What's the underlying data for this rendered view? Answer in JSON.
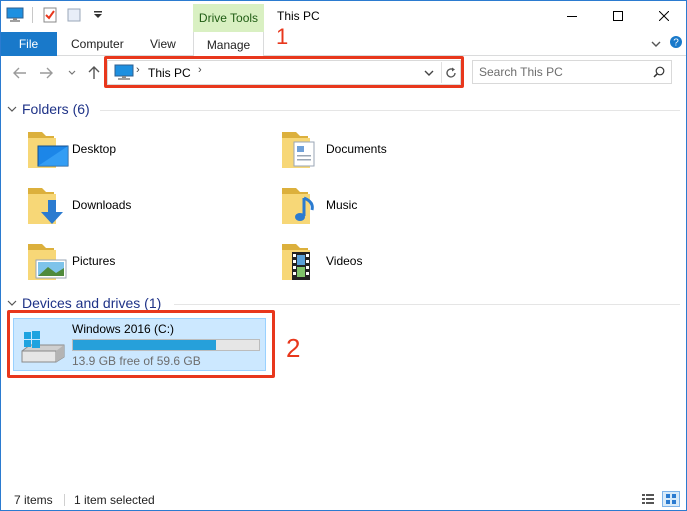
{
  "window": {
    "title": "This PC",
    "contextual_tab": "Drive Tools"
  },
  "ribbon": {
    "tabs": [
      "File",
      "Computer",
      "View",
      "Manage"
    ]
  },
  "annotations": {
    "one": "1",
    "two": "2"
  },
  "address_bar": {
    "location": "This PC"
  },
  "search": {
    "placeholder": "Search This PC"
  },
  "folders": {
    "header": "Folders (6)",
    "items": [
      {
        "label": "Desktop",
        "icon": "desktop-folder-icon"
      },
      {
        "label": "Documents",
        "icon": "documents-folder-icon"
      },
      {
        "label": "Downloads",
        "icon": "downloads-folder-icon"
      },
      {
        "label": "Music",
        "icon": "music-folder-icon"
      },
      {
        "label": "Pictures",
        "icon": "pictures-folder-icon"
      },
      {
        "label": "Videos",
        "icon": "videos-folder-icon"
      }
    ]
  },
  "devices": {
    "header": "Devices and drives (1)",
    "drive": {
      "name": "Windows 2016 (C:)",
      "free_text": "13.9 GB free of 59.6 GB",
      "used_fraction": 0.767
    }
  },
  "status": {
    "item_count": "7 items",
    "selected": "1 item selected"
  },
  "colors": {
    "accent": "#1979ca",
    "annotation": "#e8371c",
    "drive_fill": "#26a0da",
    "selection": "#cce8ff",
    "group_title": "#1e3287",
    "contextual_tab_bg": "#d9f0c2"
  }
}
